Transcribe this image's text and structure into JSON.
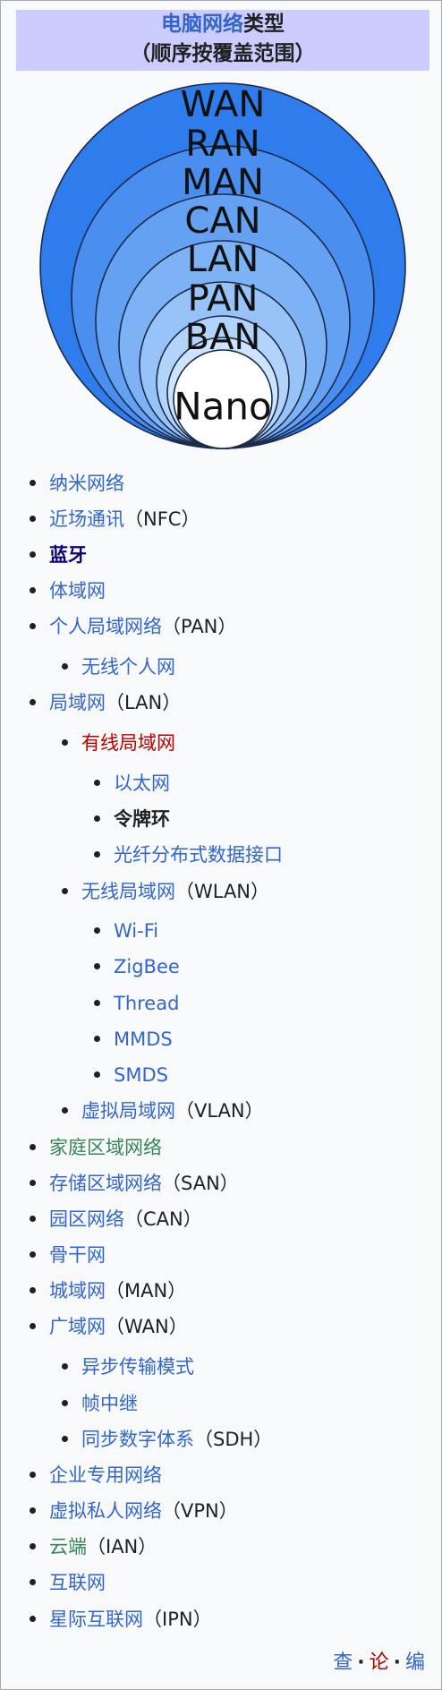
{
  "header": {
    "title_link": "电脑网络",
    "title_rest": "类型",
    "subtitle": "（顺序按覆盖范围）"
  },
  "diagram": {
    "rings": [
      "WAN",
      "RAN",
      "MAN",
      "CAN",
      "LAN",
      "PAN",
      "BAN",
      "Nano"
    ],
    "colors": [
      "#2f7ded",
      "#4a8ff0",
      "#64a1f3",
      "#7db2f5",
      "#98c3f8",
      "#b2d4fa",
      "#cde4fc",
      "#ffffff"
    ]
  },
  "items": [
    {
      "label": "纳米网络",
      "abbr": ""
    },
    {
      "label": "近场通讯",
      "abbr": "（NFC）"
    },
    {
      "label": "蓝牙",
      "abbr": ""
    },
    {
      "label": "体域网",
      "abbr": ""
    },
    {
      "label": "个人局域网络",
      "abbr": "（PAN）"
    },
    {
      "label": "无线个人网",
      "abbr": ""
    },
    {
      "label": "局域网",
      "abbr": "（LAN）"
    },
    {
      "label": "有线局域网",
      "abbr": ""
    },
    {
      "label": "以太网",
      "abbr": ""
    },
    {
      "label": "令牌环",
      "abbr": ""
    },
    {
      "label": "光纤分布式数据接口",
      "abbr": ""
    },
    {
      "label": "无线局域网",
      "abbr": "（WLAN）"
    },
    {
      "label": "Wi-Fi",
      "abbr": ""
    },
    {
      "label": "ZigBee",
      "abbr": ""
    },
    {
      "label": "Thread",
      "abbr": ""
    },
    {
      "label": "MMDS",
      "abbr": ""
    },
    {
      "label": "SMDS",
      "abbr": ""
    },
    {
      "label": "虚拟局域网",
      "abbr": "（VLAN）"
    },
    {
      "label": "家庭区域网络",
      "abbr": ""
    },
    {
      "label": "存储区域网络",
      "abbr": "（SAN）"
    },
    {
      "label": "园区网络",
      "abbr": "（CAN）"
    },
    {
      "label": "骨干网",
      "abbr": ""
    },
    {
      "label": "城域网",
      "abbr": "（MAN）"
    },
    {
      "label": "广域网",
      "abbr": "（WAN）"
    },
    {
      "label": "异步传输模式",
      "abbr": ""
    },
    {
      "label": "帧中继",
      "abbr": ""
    },
    {
      "label": "同步数字体系",
      "abbr": "（SDH）"
    },
    {
      "label": "企业专用网络",
      "abbr": ""
    },
    {
      "label": "虚拟私人网络",
      "abbr": "（VPN）"
    },
    {
      "label": "云端",
      "abbr": "（IAN）"
    },
    {
      "label": "互联网",
      "abbr": ""
    },
    {
      "label": "星际互联网",
      "abbr": "（IPN）"
    }
  ],
  "footer": {
    "view": "查",
    "talk": "论",
    "edit": "编",
    "separator": "·"
  }
}
